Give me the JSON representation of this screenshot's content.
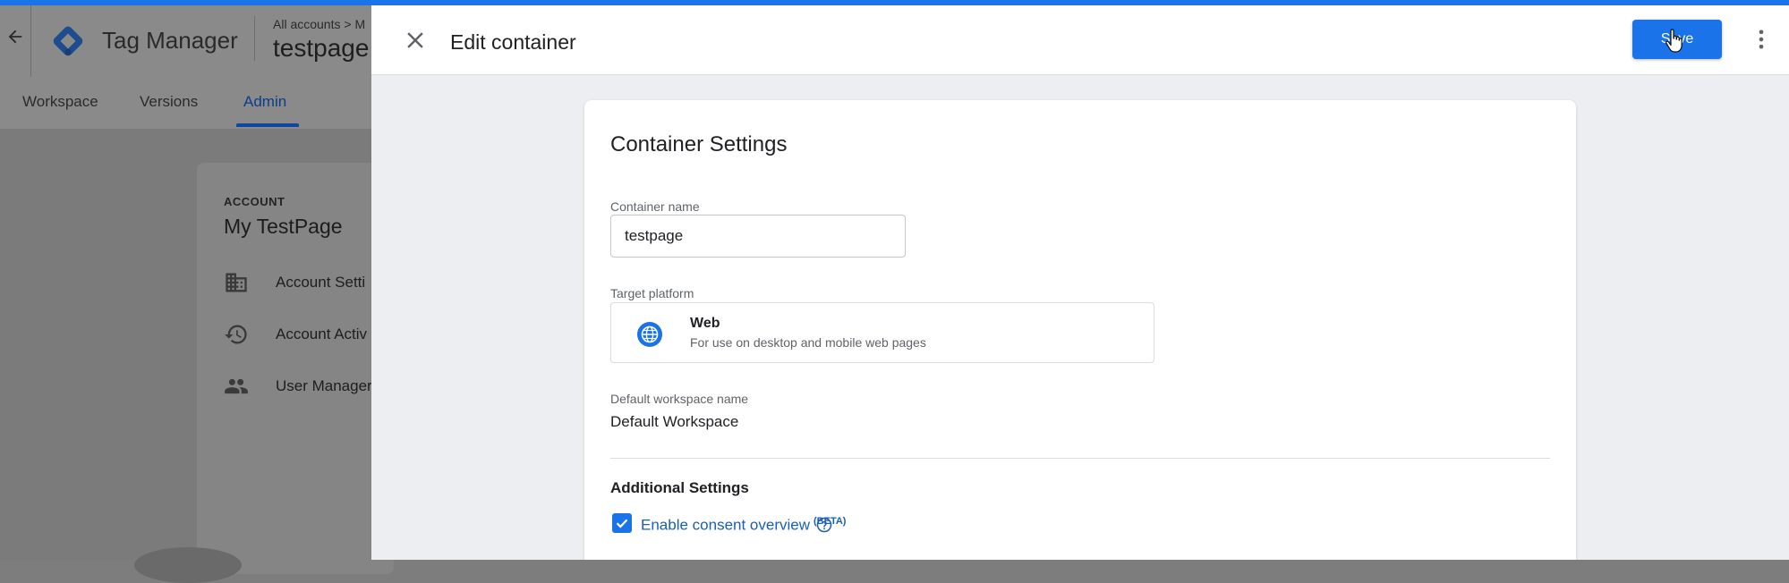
{
  "app": {
    "title": "Tag Manager",
    "breadcrumb": "All accounts > M",
    "container_name": "testpage"
  },
  "nav": {
    "tabs": [
      {
        "label": "Workspace"
      },
      {
        "label": "Versions"
      },
      {
        "label": "Admin",
        "active": true
      }
    ]
  },
  "account": {
    "section_label": "ACCOUNT",
    "name": "My TestPage",
    "items": [
      {
        "label": "Account Setti",
        "icon": "building-icon"
      },
      {
        "label": "Account Activ",
        "icon": "history-icon"
      },
      {
        "label": "User Manager",
        "icon": "people-icon"
      }
    ]
  },
  "panel": {
    "title": "Edit container",
    "save_label": "Save",
    "icons": {
      "close": "close-icon",
      "more": "more-vert-icon"
    }
  },
  "settings": {
    "title": "Container Settings",
    "container_name_label": "Container name",
    "container_name_value": "testpage",
    "target_platform_label": "Target platform",
    "platform": {
      "name": "Web",
      "description": "For use on desktop and mobile web pages",
      "icon": "globe-icon"
    },
    "workspace_label": "Default workspace name",
    "workspace_value": "Default Workspace",
    "additional_title": "Additional Settings",
    "consent_label": "Enable consent overview",
    "consent_badge": "(BETA)",
    "consent_checked": true
  },
  "colors": {
    "accent": "#1a73e8",
    "link": "#1a5fb4",
    "panel_bg": "#eceef1",
    "overlay": "#7d7d7d"
  }
}
